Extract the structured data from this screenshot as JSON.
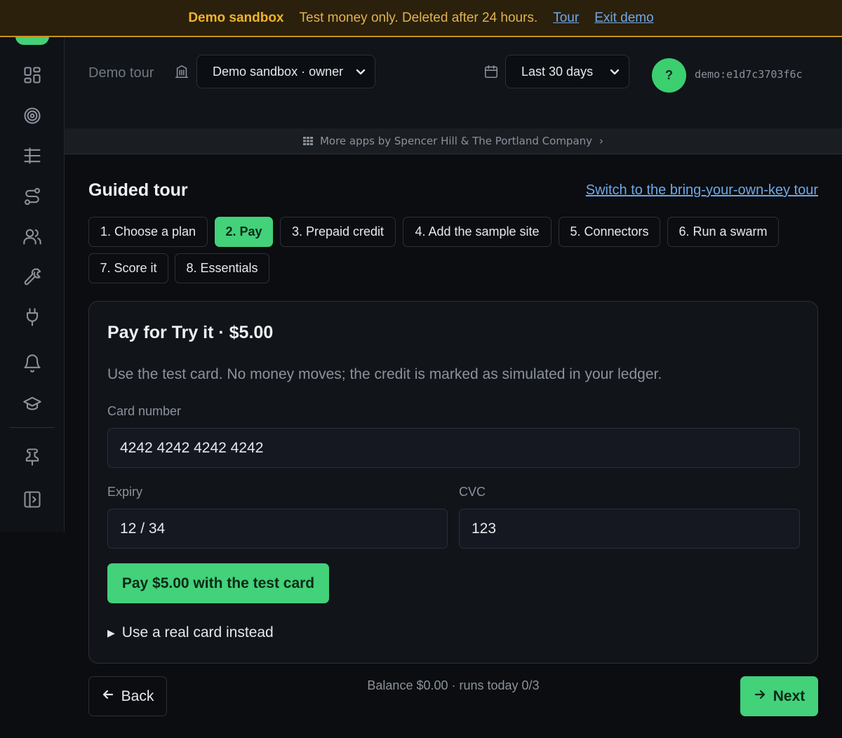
{
  "banner": {
    "label": "Demo sandbox",
    "message": "Test money only. Deleted after 24 hours.",
    "tour_link": "Tour",
    "exit_link": "Exit demo"
  },
  "sidebar": {
    "items": [
      {
        "icon": "dashboard-icon"
      },
      {
        "icon": "target-icon"
      },
      {
        "icon": "runs-icon"
      },
      {
        "icon": "route-icon"
      },
      {
        "icon": "users-icon"
      },
      {
        "icon": "wrench-icon"
      },
      {
        "icon": "plug-icon"
      },
      {
        "icon": "bell-icon"
      },
      {
        "icon": "graduation-cap-icon"
      },
      {
        "icon": "pin-icon"
      },
      {
        "icon": "collapse-sidebar-icon"
      }
    ]
  },
  "header": {
    "breadcrumb": "Demo tour",
    "workspace_select": "Demo sandbox · owner",
    "range_select": "Last 30 days",
    "avatar_initial": "?",
    "user_id": "demo:e1d7c3703f6c"
  },
  "apps_strip": {
    "text": "More apps by Spencer Hill & The Portland Company",
    "chevron": "›"
  },
  "tour": {
    "title": "Guided tour",
    "switch_link": "Switch to the bring-your-own-key tour",
    "steps": [
      "1. Choose a plan",
      "2. Pay",
      "3. Prepaid credit",
      "4. Add the sample site",
      "5. Connectors",
      "6. Run a swarm",
      "7. Score it",
      "8. Essentials"
    ],
    "active_step": 1
  },
  "card": {
    "title": "Pay for Try it · $5.00",
    "description": "Use the test card. No money moves; the credit is marked as simulated in your ledger.",
    "card_number_label": "Card number",
    "card_number_value": "4242 4242 4242 4242",
    "expiry_label": "Expiry",
    "expiry_value": "12 / 34",
    "cvc_label": "CVC",
    "cvc_value": "123",
    "pay_button": "Pay $5.00 with the test card",
    "real_card": "Use a real card instead"
  },
  "footer": {
    "back_button": "Back",
    "balance": "Balance $0.00 · runs today 0/3",
    "next_button": "Next"
  },
  "colors": {
    "accent": "#43d17a",
    "banner_text": "#f0b429",
    "link": "#6ea8e8"
  }
}
